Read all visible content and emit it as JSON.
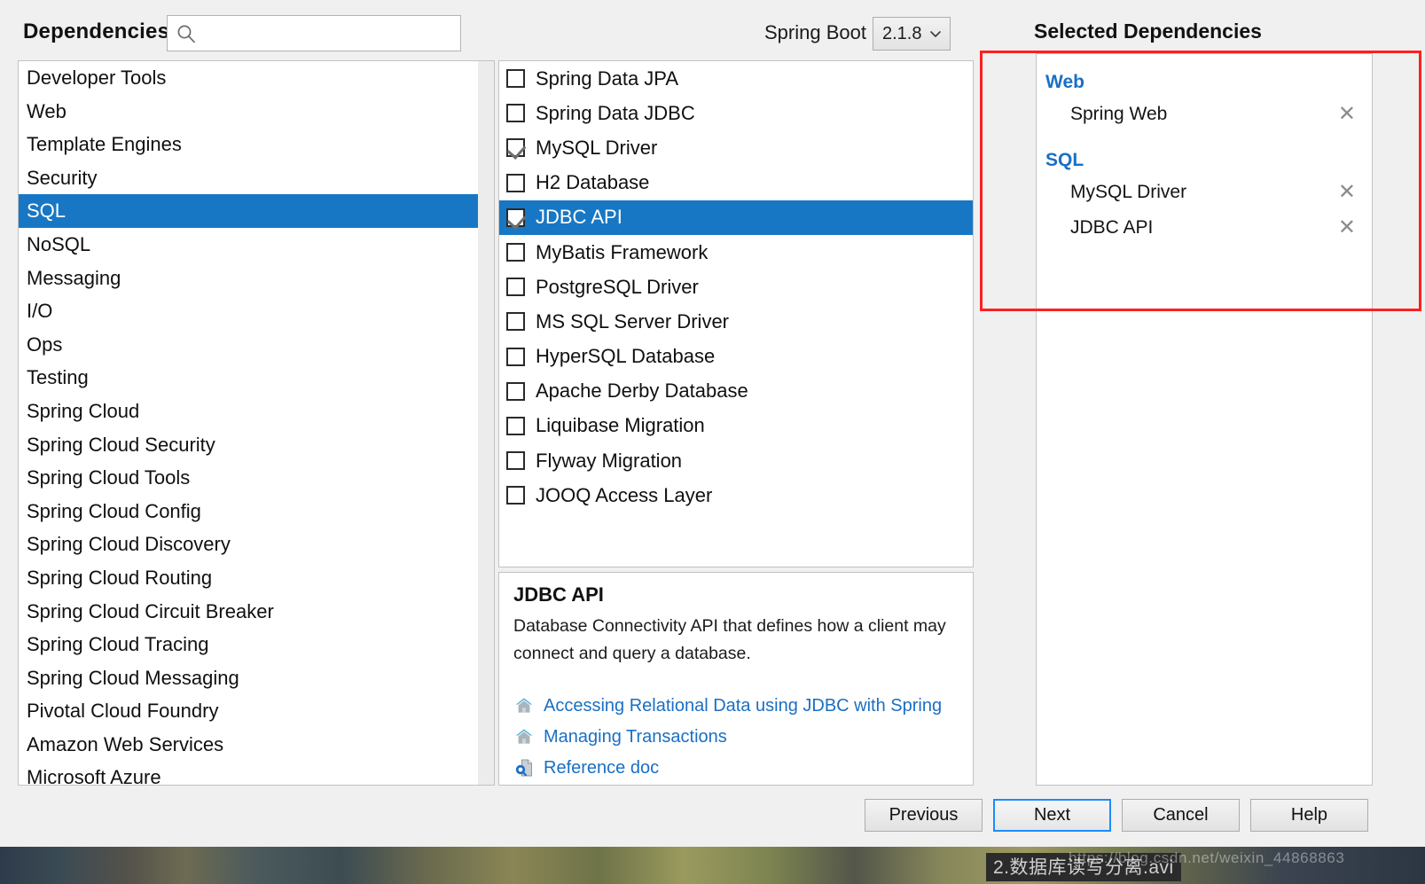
{
  "header": {
    "dependencies_label": "Dependencies",
    "search_placeholder": "",
    "search_value": "",
    "search_icon": "search-icon",
    "spring_boot_label": "Spring Boot",
    "spring_boot_version": "2.1.8",
    "chevron_icon": "chevron-down-icon",
    "selected_dependencies_label": "Selected Dependencies"
  },
  "categories": {
    "selected": "SQL",
    "items": [
      {
        "label": "Developer Tools"
      },
      {
        "label": "Web"
      },
      {
        "label": "Template Engines"
      },
      {
        "label": "Security"
      },
      {
        "label": "SQL"
      },
      {
        "label": "NoSQL"
      },
      {
        "label": "Messaging"
      },
      {
        "label": "I/O"
      },
      {
        "label": "Ops"
      },
      {
        "label": "Testing"
      },
      {
        "label": "Spring Cloud"
      },
      {
        "label": "Spring Cloud Security"
      },
      {
        "label": "Spring Cloud Tools"
      },
      {
        "label": "Spring Cloud Config"
      },
      {
        "label": "Spring Cloud Discovery"
      },
      {
        "label": "Spring Cloud Routing"
      },
      {
        "label": "Spring Cloud Circuit Breaker"
      },
      {
        "label": "Spring Cloud Tracing"
      },
      {
        "label": "Spring Cloud Messaging"
      },
      {
        "label": "Pivotal Cloud Foundry"
      },
      {
        "label": "Amazon Web Services"
      },
      {
        "label": "Microsoft Azure"
      }
    ]
  },
  "dependencies": {
    "highlighted": "JDBC API",
    "items": [
      {
        "label": "Spring Data JPA",
        "checked": false,
        "highlighted": false
      },
      {
        "label": "Spring Data JDBC",
        "checked": false,
        "highlighted": false
      },
      {
        "label": "MySQL Driver",
        "checked": true,
        "highlighted": false
      },
      {
        "label": "H2 Database",
        "checked": false,
        "highlighted": false
      },
      {
        "label": "JDBC API",
        "checked": true,
        "highlighted": true
      },
      {
        "label": "MyBatis Framework",
        "checked": false,
        "highlighted": false
      },
      {
        "label": "PostgreSQL Driver",
        "checked": false,
        "highlighted": false
      },
      {
        "label": "MS SQL Server Driver",
        "checked": false,
        "highlighted": false
      },
      {
        "label": "HyperSQL Database",
        "checked": false,
        "highlighted": false
      },
      {
        "label": "Apache Derby Database",
        "checked": false,
        "highlighted": false
      },
      {
        "label": "Liquibase Migration",
        "checked": false,
        "highlighted": false
      },
      {
        "label": "Flyway Migration",
        "checked": false,
        "highlighted": false
      },
      {
        "label": "JOOQ Access Layer",
        "checked": false,
        "highlighted": false
      }
    ]
  },
  "description": {
    "title": "JDBC API",
    "body": "Database Connectivity API that defines how a client may connect and query a database.",
    "links": [
      {
        "text": "Accessing Relational Data using JDBC with Spring",
        "icon": "home-icon"
      },
      {
        "text": "Managing Transactions",
        "icon": "home-icon"
      },
      {
        "text": "Reference doc",
        "icon": "document-search-icon"
      }
    ]
  },
  "selected_dependencies": {
    "groups": [
      {
        "name": "Web",
        "items": [
          {
            "label": "Spring Web",
            "remove_icon": "close-icon"
          }
        ]
      },
      {
        "name": "SQL",
        "items": [
          {
            "label": "MySQL Driver",
            "remove_icon": "close-icon"
          },
          {
            "label": "JDBC API",
            "remove_icon": "close-icon"
          }
        ]
      }
    ]
  },
  "footer": {
    "previous": "Previous",
    "next": "Next",
    "cancel": "Cancel",
    "help": "Help"
  },
  "desktop": {
    "taskbar_label": "2.数据库读写分离.avi",
    "watermark": "https://blog.csdn.net/weixin_44868863"
  },
  "colors": {
    "selection_blue": "#1777c4",
    "link_blue": "#1a6fc4",
    "annotation_red": "#ff1f1f",
    "dialog_bg": "#f0f0f0"
  }
}
